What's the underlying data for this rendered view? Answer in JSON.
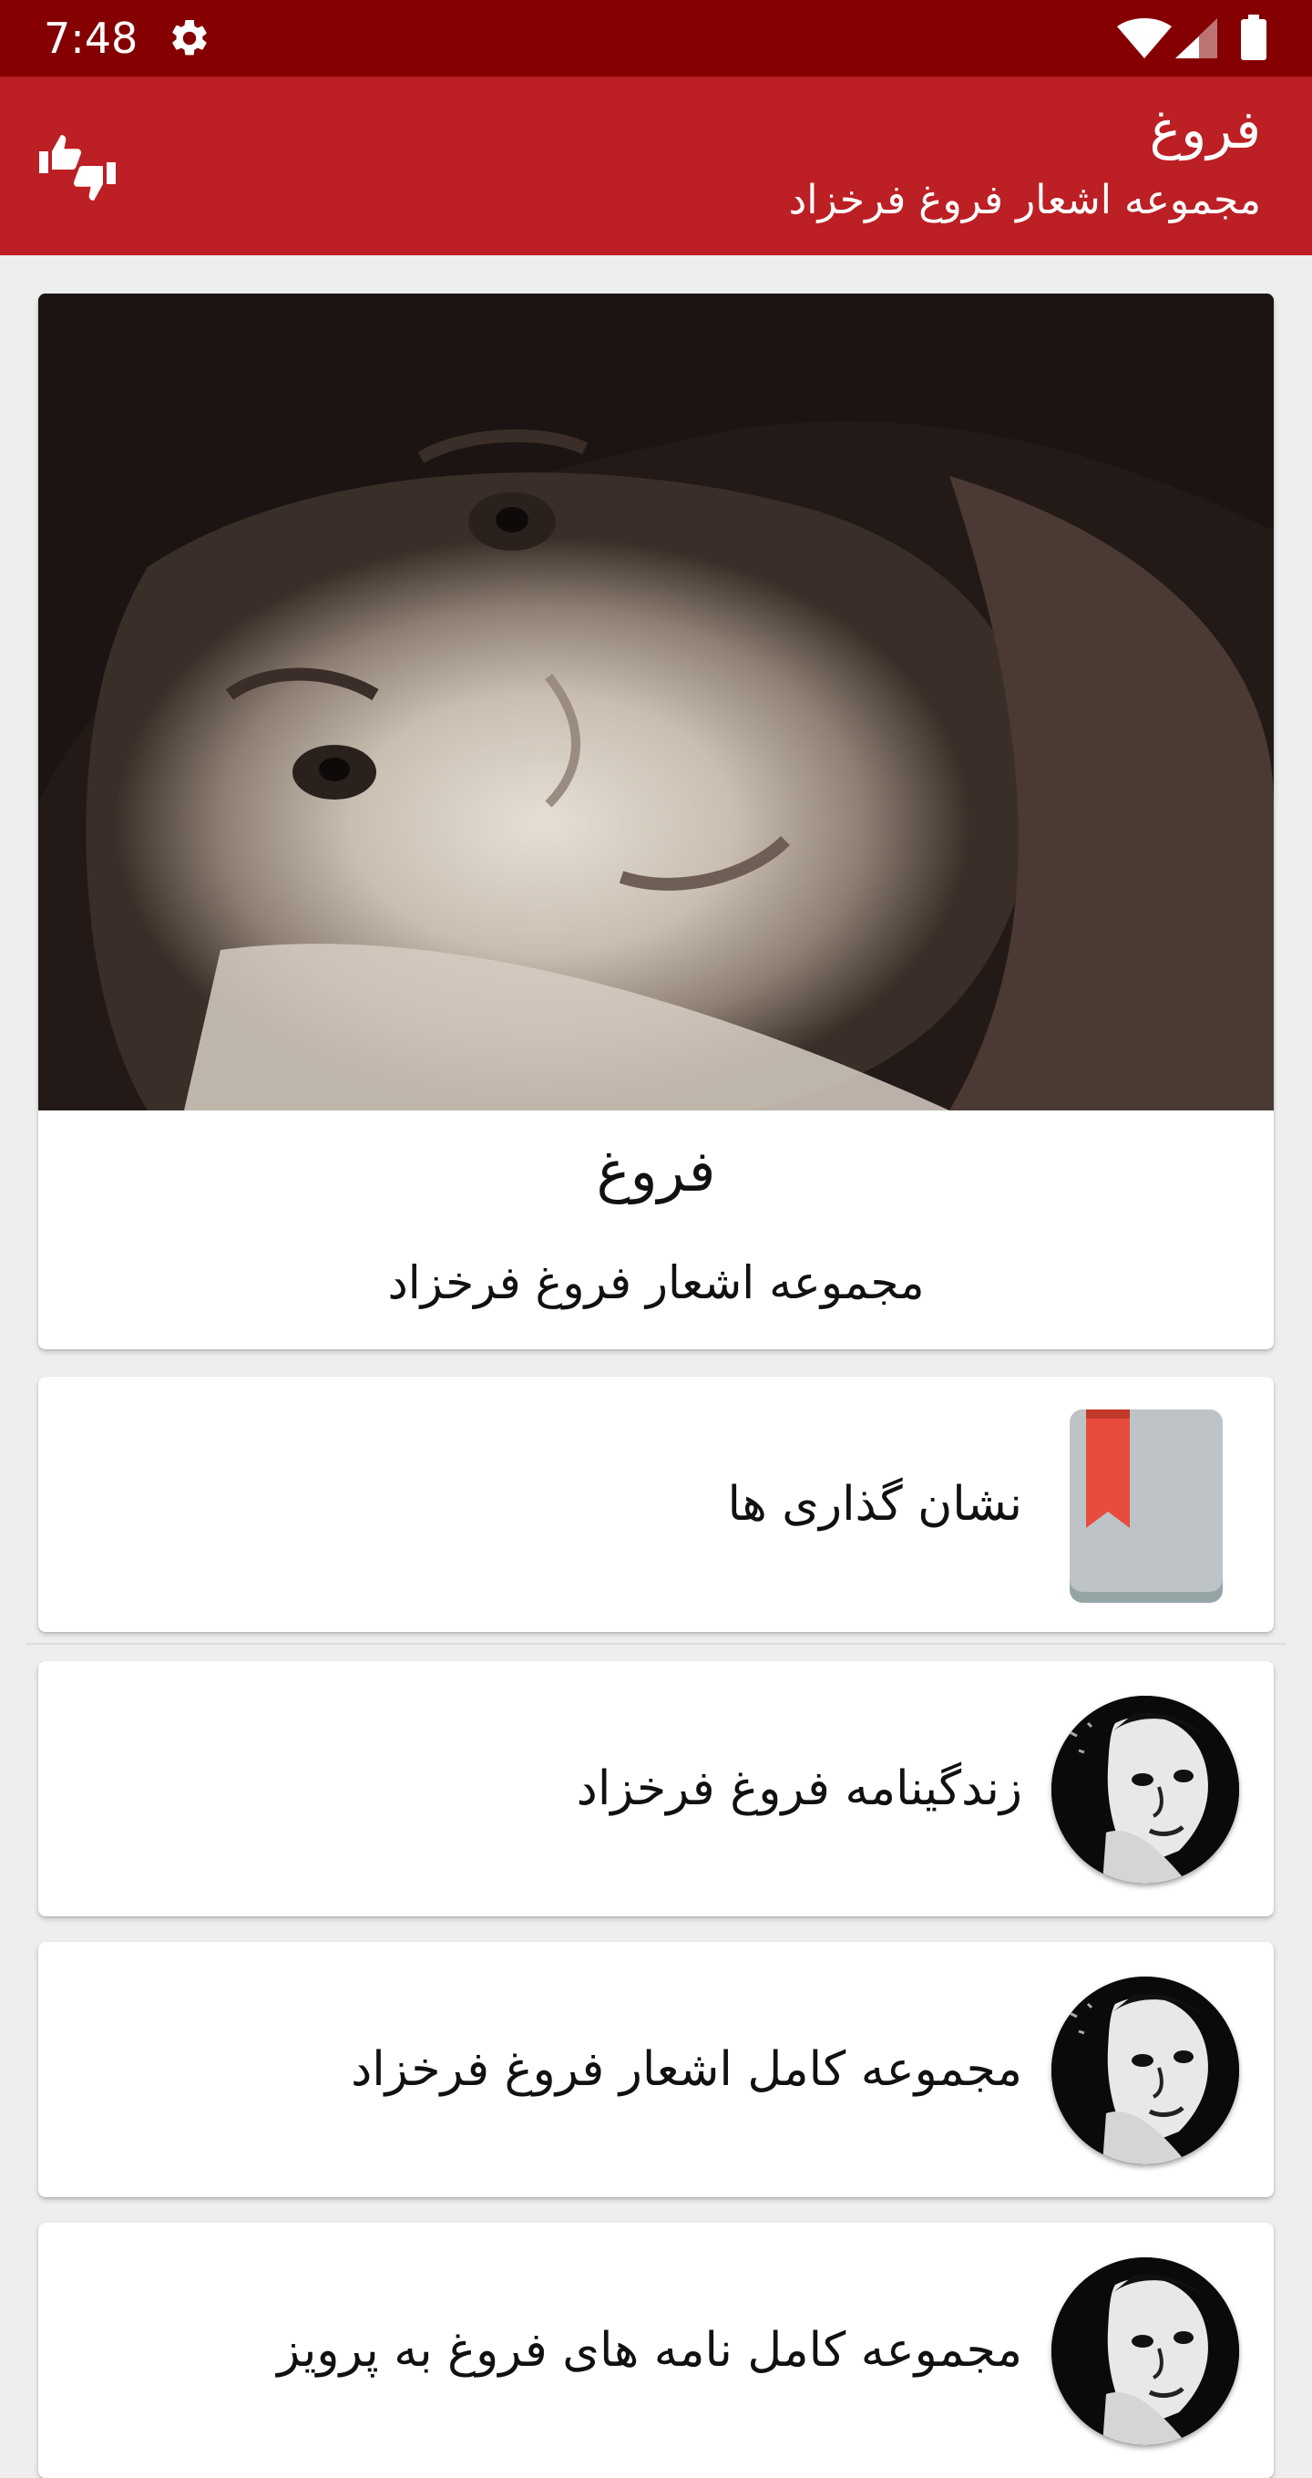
{
  "status_bar": {
    "time": "7:48",
    "icons": [
      "gear-icon",
      "wifi-icon",
      "signal-icon",
      "battery-icon"
    ]
  },
  "app_bar": {
    "title": "فروغ",
    "subtitle": "مجموعه اشعار فروغ فرخزاد",
    "action_icon": "thumbs-up-down-icon",
    "background": "#bc1f24"
  },
  "hero": {
    "title": "فروغ",
    "subtitle": "مجموعه اشعار فروغ فرخزاد"
  },
  "menu": {
    "items": [
      {
        "label": "نشان گذاری ها",
        "icon": "bookmark-icon"
      },
      {
        "label": "زندگینامه فروغ فرخزاد",
        "icon": "portrait-avatar"
      },
      {
        "label": "مجموعه کامل اشعار فروغ فرخزاد",
        "icon": "portrait-avatar"
      },
      {
        "label": "مجموعه کامل نامه های فروغ به پرویز",
        "icon": "portrait-avatar"
      }
    ]
  },
  "colors": {
    "status_bar": "#850000",
    "app_bar": "#bc1f24",
    "background": "#eeeeee",
    "bookmark_ribbon": "#e74c3c",
    "bookmark_book": "#bdc3c7"
  }
}
